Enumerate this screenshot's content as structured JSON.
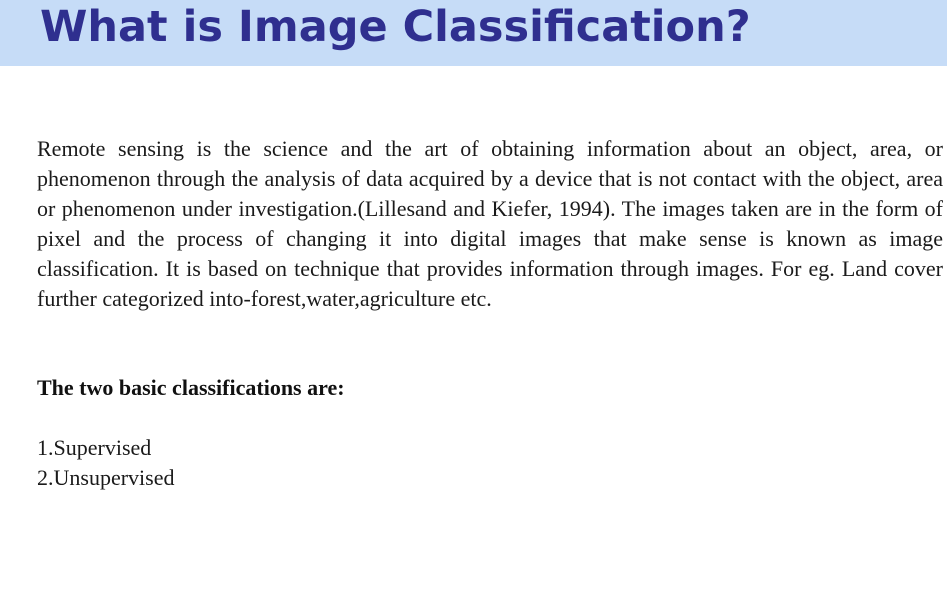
{
  "slide": {
    "title": "What is Image Classification?",
    "body": "Remote sensing is the science and the art of obtaining information about an object, area, or phenomenon through the analysis of data acquired by a device that is not contact with the object, area or phenomenon under investigation.(Lillesand and Kiefer, 1994). The images taken are in the form of pixel and the process of changing it into digital images that make sense is known as image classification. It is based on technique that provides information through images. For eg. Land cover further categorized into-forest,water,agriculture etc.",
    "subheading": "The two basic classifications are:",
    "classifications": [
      "1.Supervised",
      "2.Unsupervised"
    ]
  },
  "colors": {
    "title_band": "#c6dcf7",
    "title_text": "#2f2f8f"
  }
}
